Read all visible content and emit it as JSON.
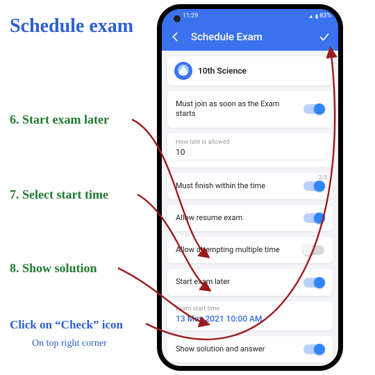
{
  "annotations": {
    "title": "Schedule exam",
    "step6": "6. Start exam later",
    "step7": "7. Select start time",
    "step8": "8. Show solution",
    "check": "Click on “Check” icon",
    "check_sub": "On top right corner"
  },
  "statusbar": {
    "time": "11:29",
    "battery": "83%"
  },
  "appbar": {
    "title": "Schedule Exam"
  },
  "class_row": {
    "name": "10th Science"
  },
  "settings": {
    "must_join": {
      "label": "Must join as soon as the Exam starts"
    },
    "late_block": {
      "label": "How late is allowed",
      "value": "10"
    },
    "must_finish": {
      "label": "Must finish within the time",
      "counter": "2/3"
    },
    "allow_resume": {
      "label": "Allow resume exam"
    },
    "allow_multiple": {
      "label": "Allow attempting multiple time"
    },
    "start_later": {
      "label": "Start exam later"
    },
    "start_time_block": {
      "label": "Exam start time",
      "value": "13 May 2021 10:00 AM"
    },
    "show_solution": {
      "label": "Show solution and answer"
    }
  }
}
